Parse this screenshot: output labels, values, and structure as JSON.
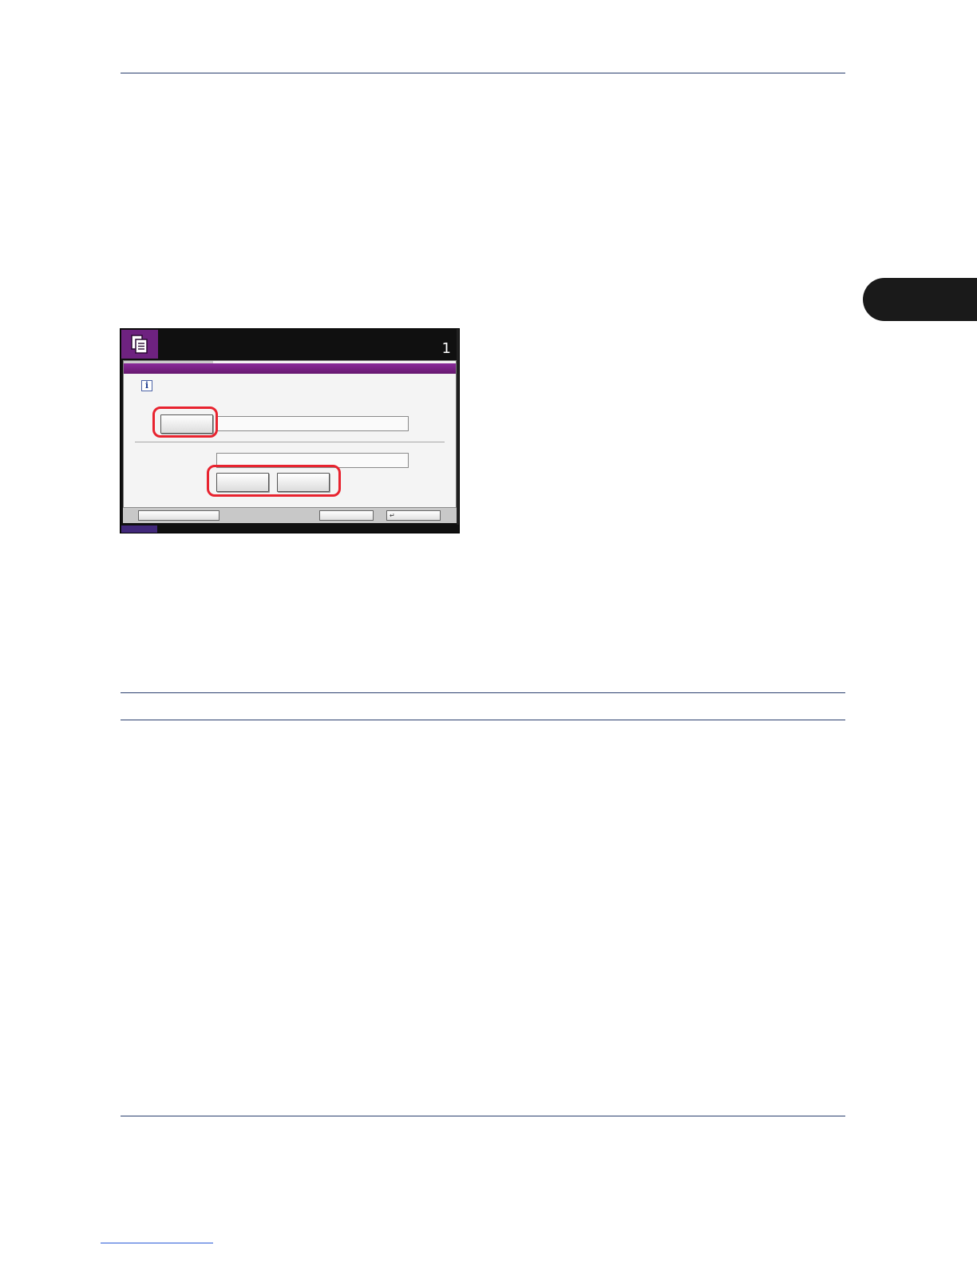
{
  "panel": {
    "count": "1",
    "info_glyph": "i",
    "enter_glyph": "↵",
    "icons": {
      "copy": "copy-icon",
      "info": "info-icon",
      "enter": "enter-icon"
    },
    "colors": {
      "header_accent": "#6e2280",
      "title_bar": "#7a238a",
      "highlight": "#e8232f"
    }
  }
}
